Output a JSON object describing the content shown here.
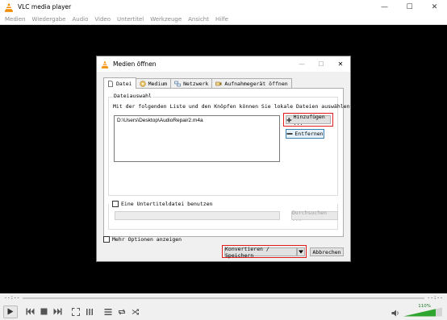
{
  "app": {
    "title": "VLC media player",
    "window_controls": [
      "—",
      "☐",
      "✕"
    ]
  },
  "menu": [
    "Medien",
    "Wiedergabe",
    "Audio",
    "Video",
    "Untertitel",
    "Werkzeuge",
    "Ansicht",
    "Hilfe"
  ],
  "dialog": {
    "title": "Medien öffnen",
    "tabs": [
      {
        "label": "Datei",
        "icon": "file-icon"
      },
      {
        "label": "Medium",
        "icon": "disc-icon"
      },
      {
        "label": "Netzwerk",
        "icon": "network-icon"
      },
      {
        "label": "Aufnahmegerät öffnen",
        "icon": "capture-icon"
      }
    ],
    "file_selection": {
      "group_title": "Dateiauswahl",
      "description": "Mit der folgenden Liste und den Knöpfen können Sie lokale Dateien auswählen.",
      "files": [
        "D:\\Users\\Desktop\\AudioRepair2.m4a"
      ],
      "add_label": "Hinzufügen ...",
      "remove_label": "Entfernen"
    },
    "subtitle": {
      "checkbox_label": "Eine Untertiteldatei benutzen",
      "browse_label": "Durchsuchen ..."
    },
    "more_options_label": "Mehr Optionen anzeigen",
    "convert_label": "Konvertieren / Speichern",
    "cancel_label": "Abbrechen"
  },
  "player": {
    "time_elapsed": "--:--",
    "time_total": "--:--",
    "volume_percent": "110%"
  },
  "colors": {
    "highlight": "#e0191b",
    "vlc_orange": "#f28c00",
    "volume_green": "#2ea52e"
  }
}
